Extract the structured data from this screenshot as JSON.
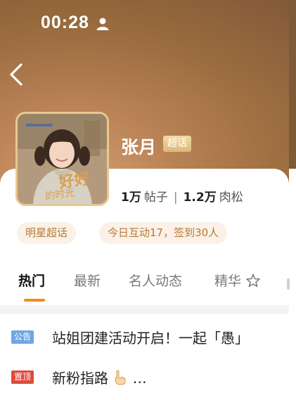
{
  "status_bar": {
    "time": "00:28"
  },
  "profile": {
    "name": "张月",
    "super_badge": "超话",
    "posts_count": "1万",
    "posts_label": "帖子",
    "fans_count": "1.2万",
    "fans_label": "肉松"
  },
  "tags": [
    "明星超话",
    "今日互动17，签到30人"
  ],
  "tabs": [
    {
      "label": "热门"
    },
    {
      "label": "最新"
    },
    {
      "label": "名人动态"
    },
    {
      "label": "精华"
    }
  ],
  "posts": [
    {
      "badge": "公告",
      "title": "站姐团建活动开启！一起「愚」"
    },
    {
      "badge": "置顶",
      "title": "新粉指路",
      "suffix": "…"
    }
  ],
  "colors": {
    "accent": "#f28b1e",
    "notice_badge": "#6ea7e5",
    "top_badge": "#e0493c",
    "super_badge": "#e0b878",
    "tag_bg": "#fbf1e6",
    "tag_text": "#b57a3b"
  }
}
